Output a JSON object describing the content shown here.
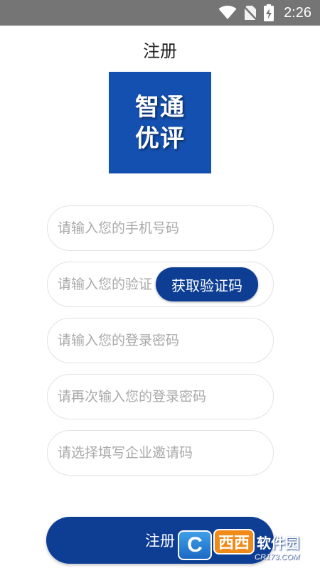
{
  "status_bar": {
    "time": "2:26",
    "icons": [
      "wifi-icon",
      "no-sim-icon",
      "battery-charging-icon"
    ]
  },
  "page": {
    "title": "注册"
  },
  "logo": {
    "line1": "智通",
    "line2": "优评",
    "color": "#1450b0"
  },
  "form": {
    "phone_placeholder": "请输入您的手机号码",
    "code_placeholder": "请输入您的验证码",
    "get_code_label": "获取验证码",
    "password_placeholder": "请输入您的登录密码",
    "confirm_password_placeholder": "请再次输入您的登录密码",
    "invite_code_placeholder": "请选择填写企业邀请码",
    "register_label": "注册"
  },
  "colors": {
    "primary": "#0e3e94",
    "status_bar": "#757575"
  },
  "watermark": {
    "badge": "C",
    "xixi": "西西",
    "site": "软件园",
    "url": "CR173.COM"
  }
}
